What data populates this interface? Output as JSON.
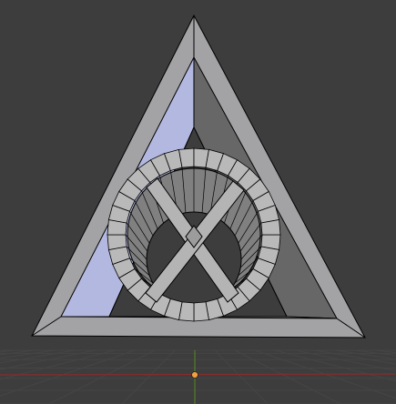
{
  "viewport": {
    "background": "#3d3d3d",
    "grid_color": "#454545",
    "x_axis_color": "#8a2b2b",
    "y_axis_color": "#4f7f2a",
    "origin_color": "#f0a040"
  },
  "object": {
    "name": "deathly-hallows-mesh",
    "frame_face_color": "#a3a3a6",
    "frame_edge_color": "#000000",
    "inner_left_face_color": "#b3b8e0",
    "inner_right_face_color": "#676767",
    "inner_bottom_face_color": "#8b8b8b",
    "ring_face_color": "#b9b9b9",
    "ring_segments": 36,
    "cross_face_color": "#b4b4b4"
  }
}
